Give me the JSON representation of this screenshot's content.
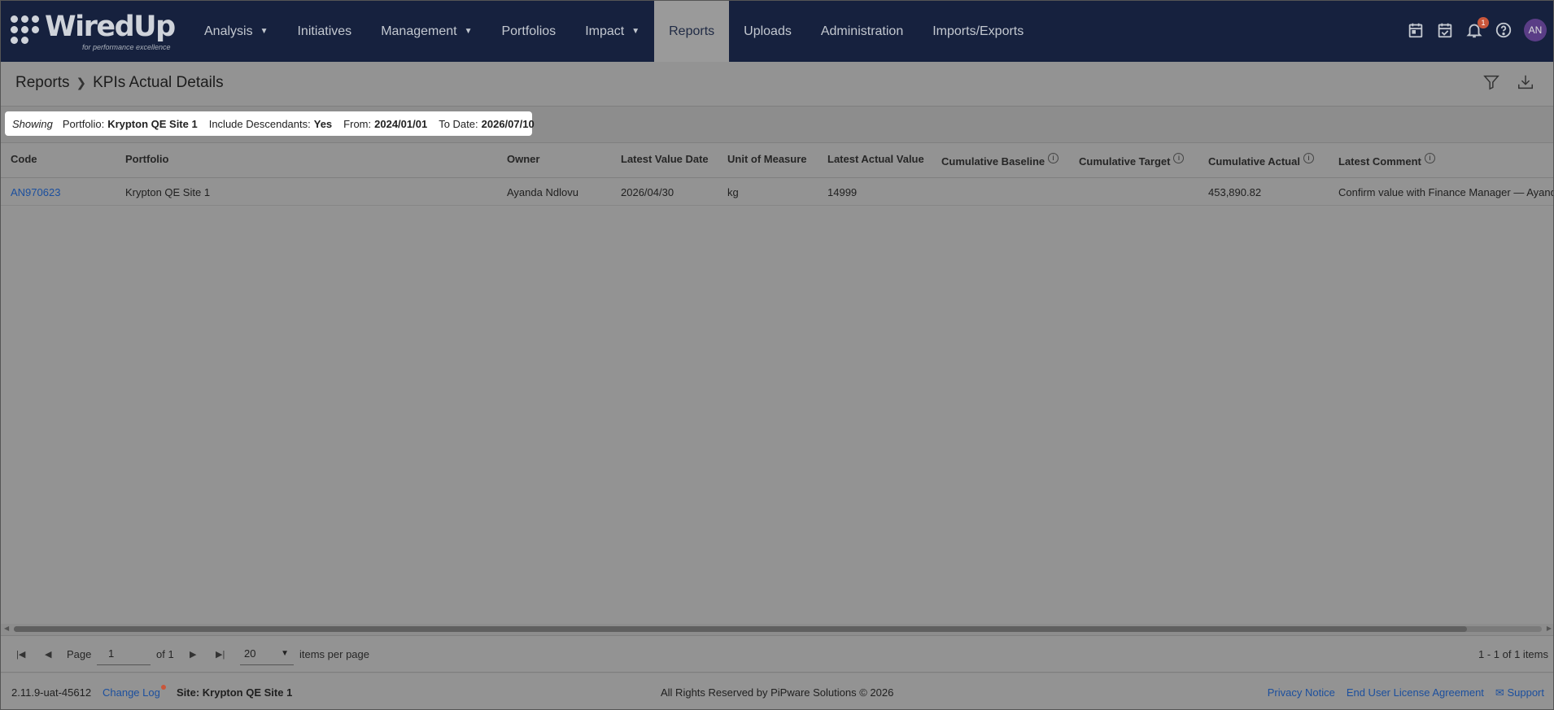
{
  "brand": {
    "name": "WiredUp",
    "tagline": "for performance excellence"
  },
  "nav": {
    "items": [
      {
        "label": "Analysis",
        "dropdown": true
      },
      {
        "label": "Initiatives",
        "dropdown": false
      },
      {
        "label": "Management",
        "dropdown": true
      },
      {
        "label": "Portfolios",
        "dropdown": false
      },
      {
        "label": "Impact",
        "dropdown": true
      },
      {
        "label": "Reports",
        "dropdown": false,
        "active": true
      },
      {
        "label": "Uploads",
        "dropdown": false
      },
      {
        "label": "Administration",
        "dropdown": false
      },
      {
        "label": "Imports/Exports",
        "dropdown": false
      }
    ],
    "notification_count": "1",
    "avatar_initials": "AN"
  },
  "header": {
    "crumb_parent": "Reports",
    "crumb_current": "KPIs Actual Details"
  },
  "filter": {
    "showing": "Showing",
    "portfolio_label": "Portfolio:",
    "portfolio_value": "Krypton QE Site 1",
    "descendants_label": "Include Descendants:",
    "descendants_value": "Yes",
    "from_label": "From:",
    "from_value": "2024/01/01",
    "to_label": "To Date:",
    "to_value": "2026/07/10"
  },
  "table": {
    "columns": [
      "Code",
      "Portfolio",
      "Owner",
      "Latest Value Date",
      "Unit of Measure",
      "Latest Actual Value",
      "Cumulative Baseline",
      "Cumulative Target",
      "Cumulative Actual",
      "Latest Comment"
    ],
    "rows": [
      [
        "AN970623",
        "Krypton QE Site 1",
        "Ayanda Ndlovu",
        "2026/04/30",
        "kg",
        "14999",
        "",
        "",
        "453,890.82",
        "Confirm value with Finance Manager — Ayand"
      ]
    ]
  },
  "pager": {
    "page_label": "Page",
    "page_value": "1",
    "of_label": "of 1",
    "page_size": "20",
    "items_per_page": "items per page",
    "total": "1 - 1 of 1 items"
  },
  "footer": {
    "version": "2.11.9-uat-45612",
    "changelog": "Change Log",
    "site": "Site: Krypton QE Site 1",
    "rights": "All Rights Reserved by PiPware Solutions © 2026",
    "privacy": "Privacy Notice",
    "eula": "End User License Agreement",
    "support": "Support"
  }
}
